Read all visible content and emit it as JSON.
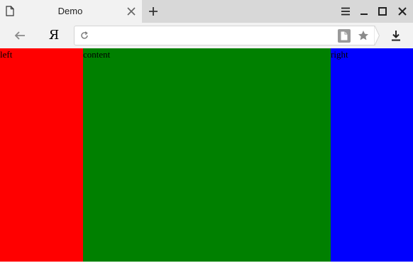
{
  "tab": {
    "title": "Demo"
  },
  "toolbar": {
    "search_engine_letter": "Я",
    "address": {
      "value": "",
      "placeholder": ""
    }
  },
  "page": {
    "columns": {
      "left": {
        "text": "left",
        "color": "#ff0000"
      },
      "content": {
        "text": "content",
        "color": "#008000"
      },
      "right": {
        "text": "right",
        "color": "#0000ff"
      }
    }
  },
  "colors": {
    "tab_strip": "#d8d8d8",
    "active_tab": "#f2f2f2",
    "toolbar": "#f2f2f2",
    "icon": "#333333"
  },
  "icons": {
    "tab": "page-icon",
    "tab_close": "close-icon",
    "new_tab": "plus-icon",
    "window_menu": "hamburger-menu-icon",
    "window_minimize": "minimize-icon",
    "window_maximize": "maximize-icon",
    "window_close": "close-icon",
    "back": "back-arrow-icon",
    "reload": "reload-icon",
    "reader_mode": "document-icon",
    "bookmark": "star-icon",
    "downloads": "download-icon"
  }
}
